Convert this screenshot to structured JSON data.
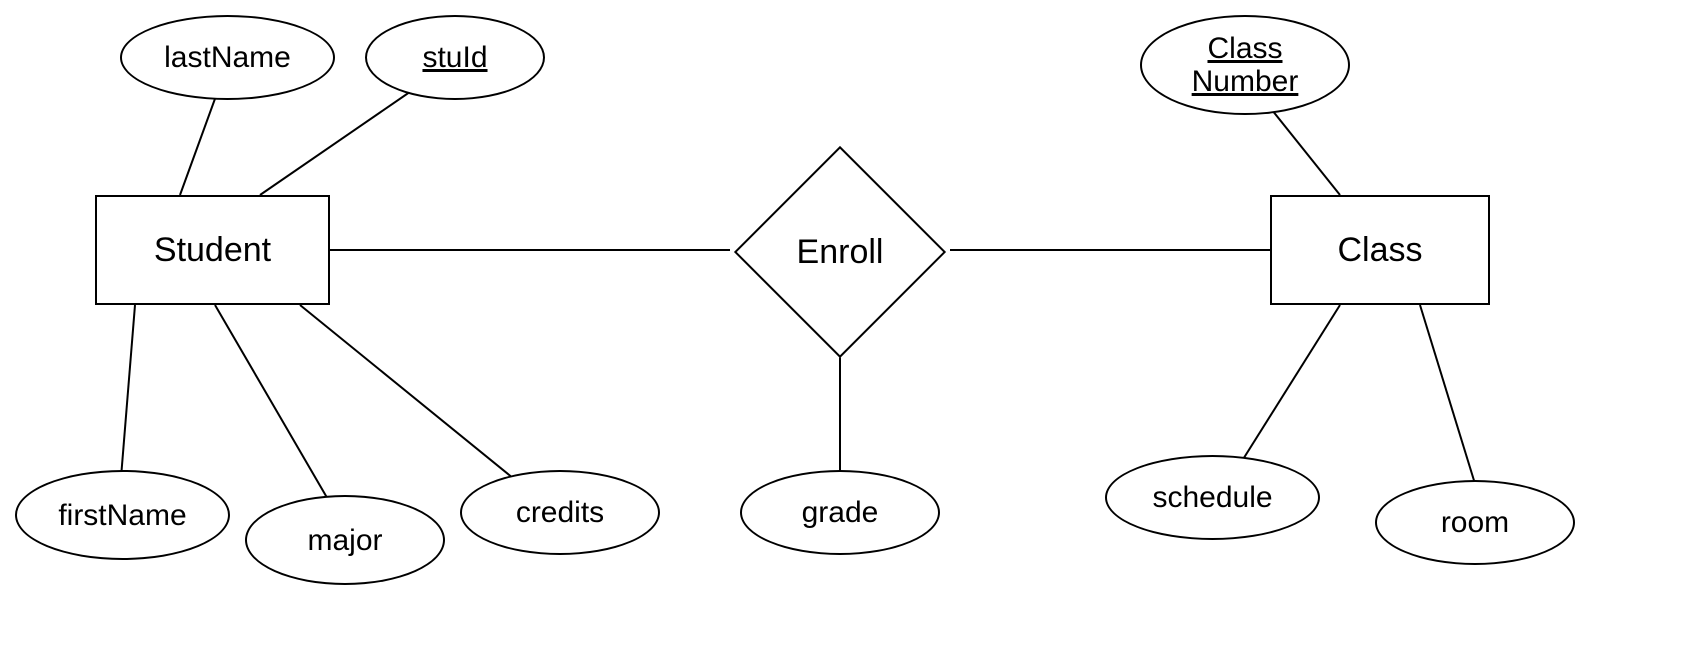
{
  "entities": {
    "student": {
      "label": "Student"
    },
    "class": {
      "label": "Class"
    }
  },
  "relationship": {
    "enroll": {
      "label": "Enroll"
    }
  },
  "attributes": {
    "lastName": {
      "label": "lastName"
    },
    "stuId": {
      "label": "stuId"
    },
    "firstName": {
      "label": "firstName"
    },
    "major": {
      "label": "major"
    },
    "credits": {
      "label": "credits"
    },
    "grade": {
      "label": "grade"
    },
    "classNumber": {
      "label1": "Class",
      "label2": "Number"
    },
    "schedule": {
      "label": "schedule"
    },
    "room": {
      "label": "room"
    }
  }
}
